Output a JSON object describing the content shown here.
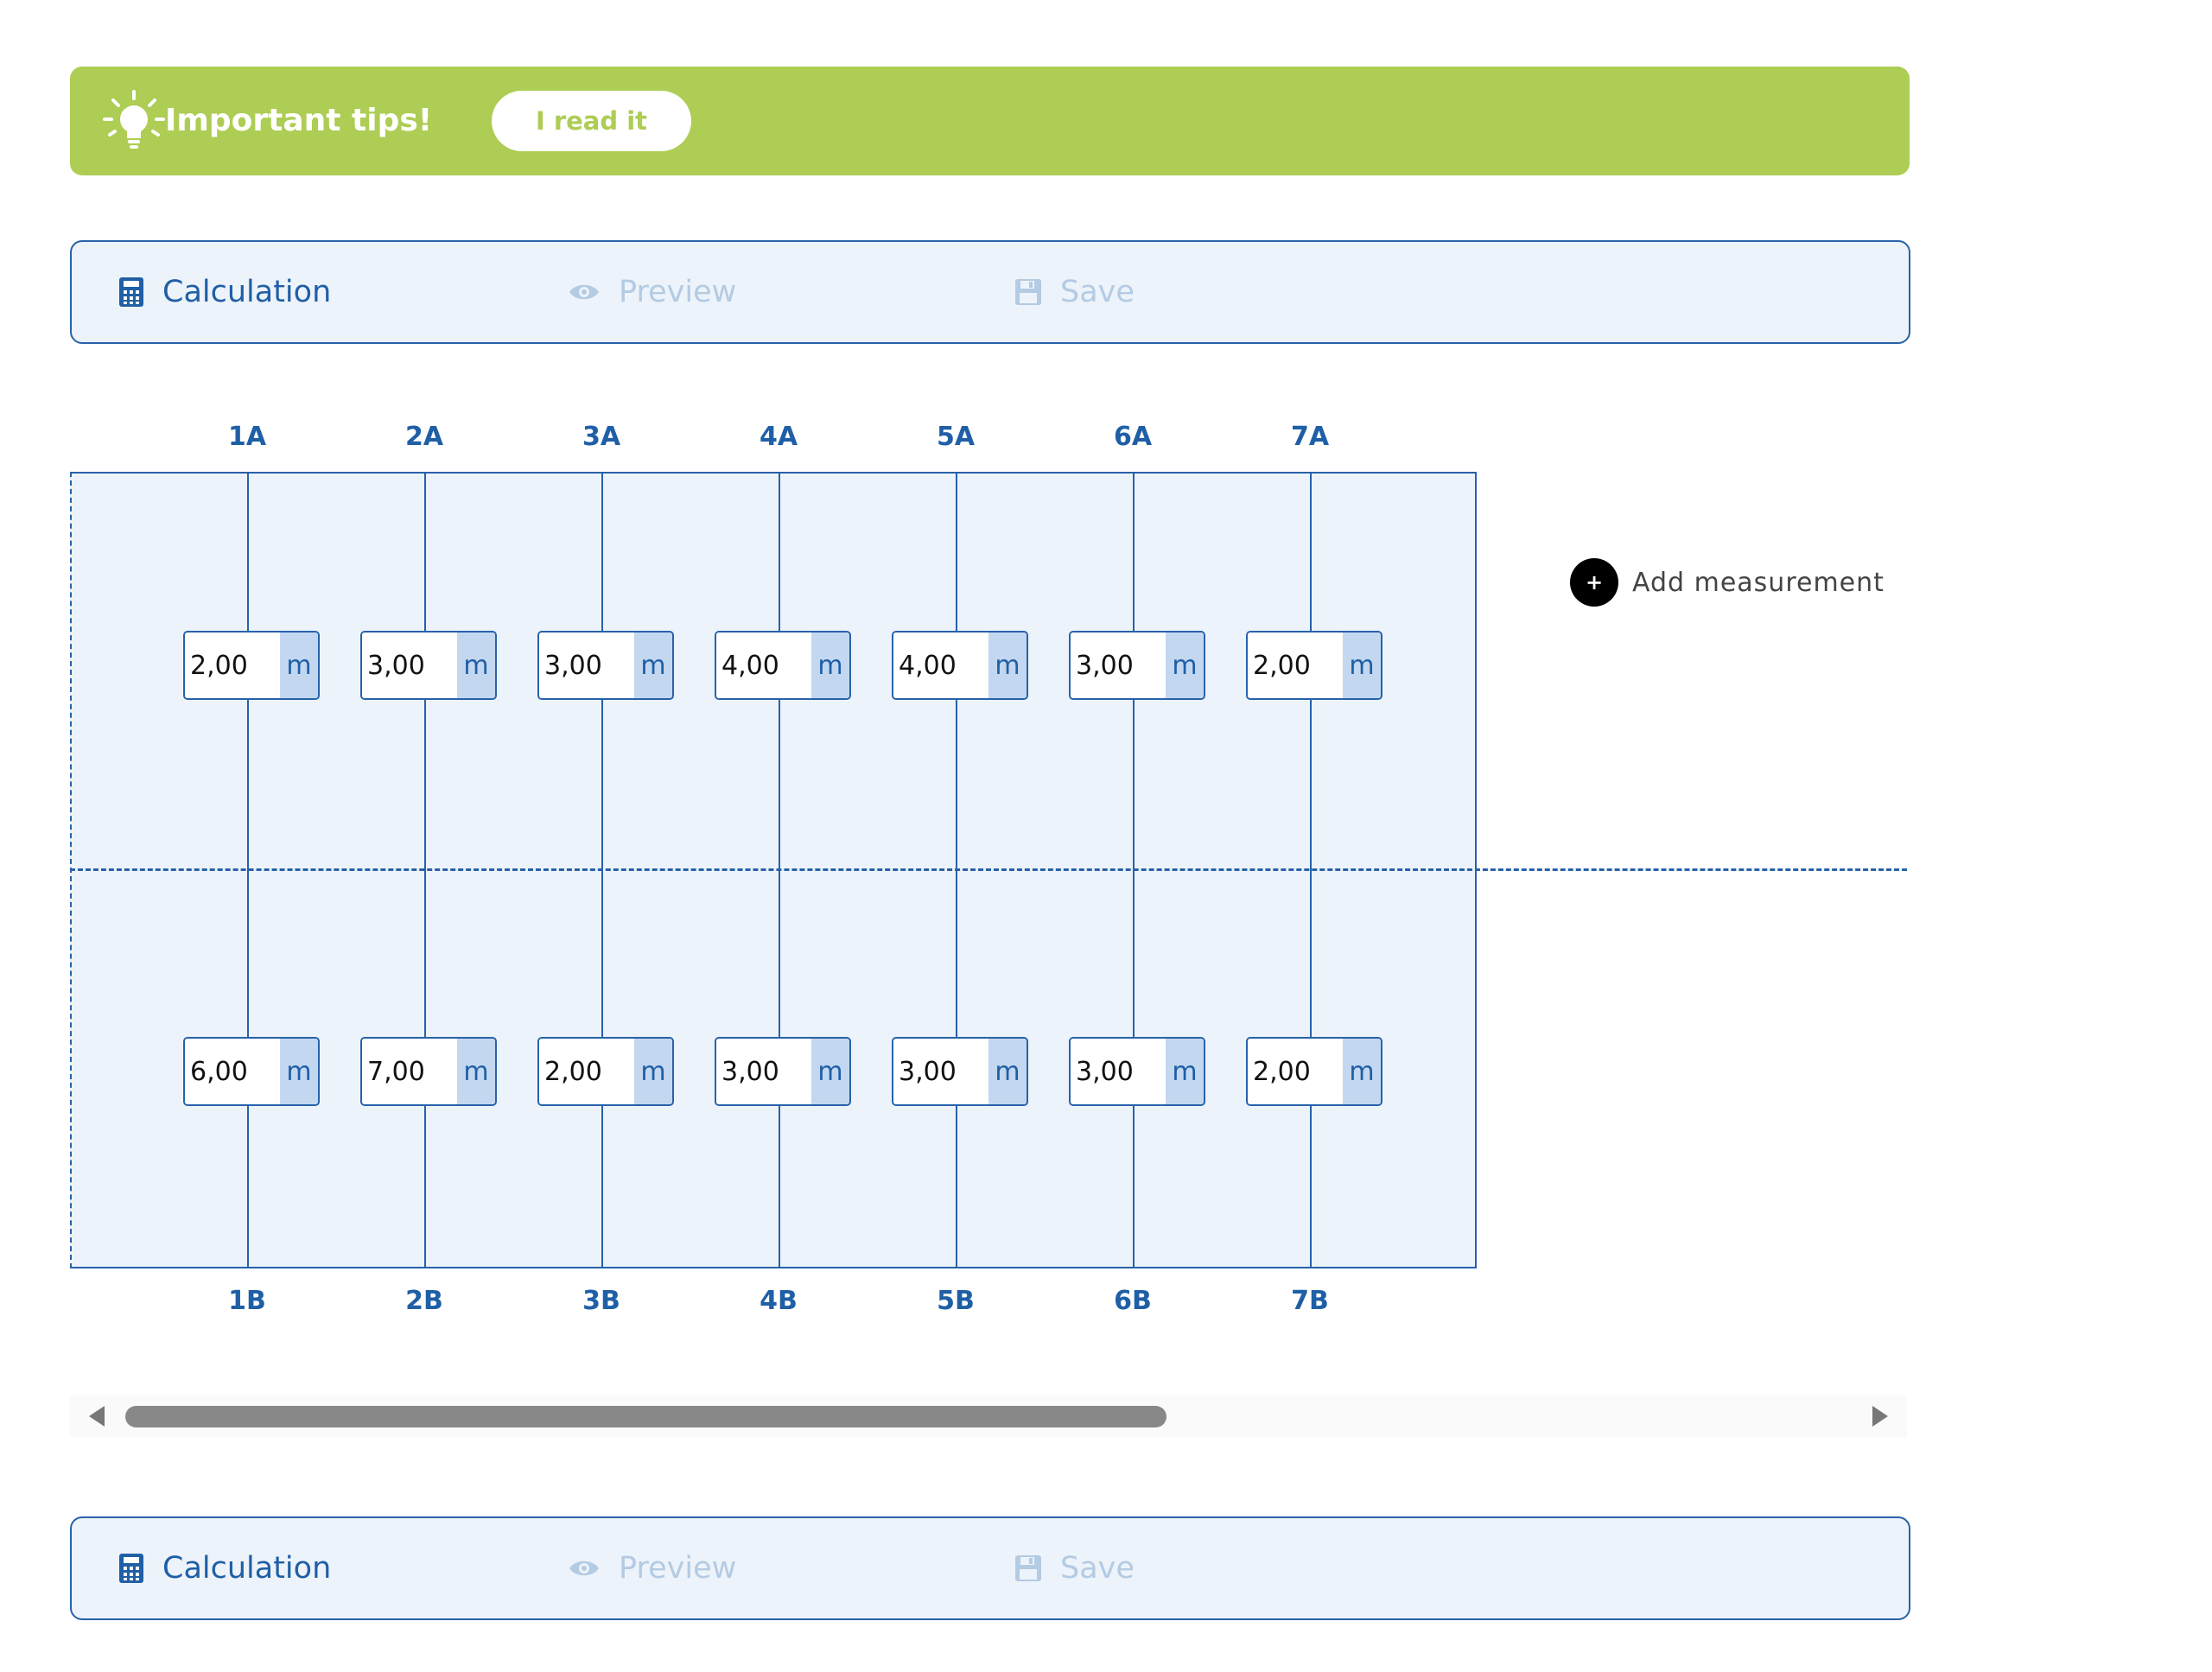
{
  "tips": {
    "title": "Important tips!",
    "button_label": "I read it",
    "icon": "lightbulb-icon"
  },
  "toolbar_top": {
    "calculation": {
      "label": "Calculation",
      "icon": "calculator-icon"
    },
    "preview": {
      "label": "Preview",
      "icon": "eye-icon"
    },
    "save": {
      "label": "Save",
      "icon": "floppy-disk-icon"
    }
  },
  "toolbar_bottom": {
    "calculation": {
      "label": "Calculation",
      "icon": "calculator-icon"
    },
    "preview": {
      "label": "Preview",
      "icon": "eye-icon"
    },
    "save": {
      "label": "Save",
      "icon": "floppy-disk-icon"
    }
  },
  "columns_top": [
    "1A",
    "2A",
    "3A",
    "4A",
    "5A",
    "6A",
    "7A"
  ],
  "columns_bottom": [
    "1B",
    "2B",
    "3B",
    "4B",
    "5B",
    "6B",
    "7B"
  ],
  "measurements_a": [
    "2,00",
    "3,00",
    "3,00",
    "4,00",
    "4,00",
    "3,00",
    "2,00"
  ],
  "measurements_b": [
    "6,00",
    "7,00",
    "2,00",
    "3,00",
    "3,00",
    "3,00",
    "2,00"
  ],
  "unit": "m",
  "add_measurement": {
    "label": "Add measurement",
    "icon": "plus-circle-icon"
  },
  "colors": {
    "accent": "#2762aa",
    "tips_bg": "#adcd54",
    "area_bg": "#edf3fa",
    "unit_bg": "#c3d7f0",
    "disabled": "#b3cbe3"
  }
}
